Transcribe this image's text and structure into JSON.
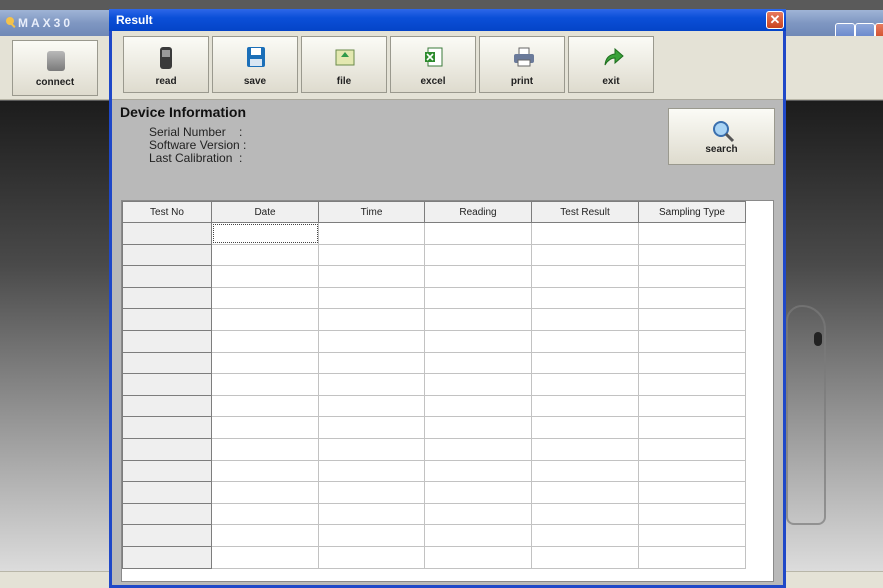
{
  "background_app": {
    "title": "MAX30",
    "connect_label": "connect"
  },
  "dialog": {
    "title": "Result",
    "close_glyph": "✕"
  },
  "toolbar": {
    "buttons": [
      {
        "label": "read",
        "icon": "device-icon"
      },
      {
        "label": "save",
        "icon": "floppy-disk-icon"
      },
      {
        "label": "file",
        "icon": "folder-icon"
      },
      {
        "label": "excel",
        "icon": "excel-icon"
      },
      {
        "label": "print",
        "icon": "printer-icon"
      },
      {
        "label": "exit",
        "icon": "arrow-exit-icon"
      }
    ]
  },
  "device_info": {
    "title": "Device Information",
    "rows": [
      {
        "label": "Serial Number    :"
      },
      {
        "label": "Software Version :"
      },
      {
        "label": "Last Calibration  :"
      }
    ],
    "search_label": "search"
  },
  "grid": {
    "columns": [
      "Test No",
      "Date",
      "Time",
      "Reading",
      "Test Result",
      "Sampling Type"
    ],
    "row_count": 16
  },
  "colors": {
    "dialog_title_blue": "#0b4fd8",
    "dialog_body": "#b9b9b9",
    "toolbar": "#e4e2d6"
  }
}
